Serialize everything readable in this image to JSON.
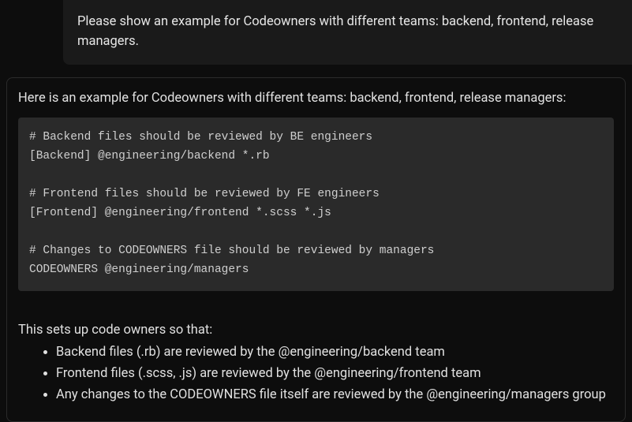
{
  "user_message": "Please show an example for Codeowners with different teams: backend, frontend, release managers.",
  "assistant": {
    "intro": "Here is an example for Codeowners with different teams: backend, frontend, release managers:",
    "code": "# Backend files should be reviewed by BE engineers\n[Backend] @engineering/backend *.rb\n\n# Frontend files should be reviewed by FE engineers\n[Frontend] @engineering/frontend *.scss *.js\n\n# Changes to CODEOWNERS file should be reviewed by managers\nCODEOWNERS @engineering/managers",
    "summary_intro": "This sets up code owners so that:",
    "bullets": [
      "Backend files (.rb) are reviewed by the @engineering/backend team",
      "Frontend files (.scss, .js) are reviewed by the @engineering/frontend team",
      "Any changes to the CODEOWNERS file itself are reviewed by the @engineering/managers group"
    ]
  }
}
